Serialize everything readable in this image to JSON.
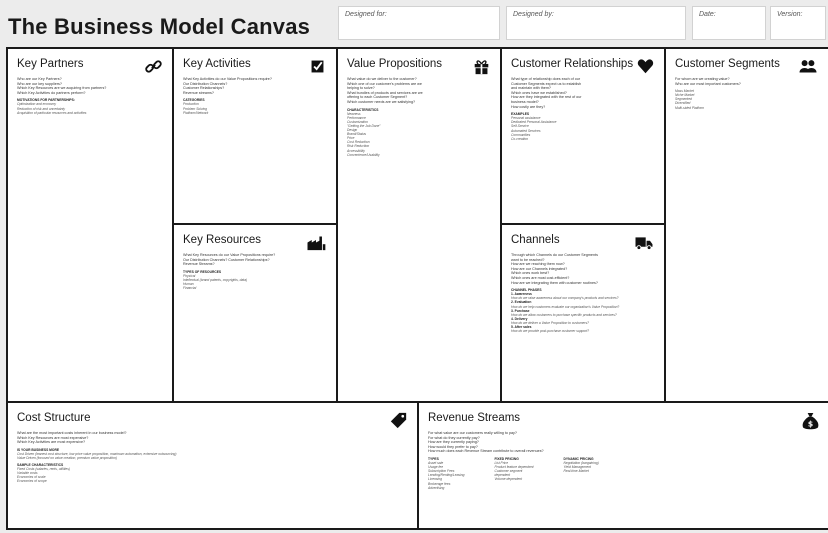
{
  "header": {
    "title": "The Business Model Canvas",
    "designed_for_label": "Designed for:",
    "designed_by_label": "Designed by:",
    "date_label": "Date:",
    "version_label": "Version:"
  },
  "key_partners": {
    "title": "Key Partners",
    "icon": "link-icon",
    "questions": [
      "Who are our Key Partners?",
      "Who are our key suppliers?",
      "Which Key Resources are we acquiring from partners?",
      "Which Key Activities do partners perform?"
    ],
    "section_heading": "MOTIVATIONS FOR PARTNERSHIPS:",
    "section_items": [
      "Optimization and economy",
      "Reduction of risk and uncertainty",
      "Acquisition of particular resources and activities"
    ]
  },
  "key_activities": {
    "title": "Key Activities",
    "icon": "checkbox-icon",
    "questions": [
      "What Key Activities do our Value Propositions require?",
      "Our Distribution Channels?",
      "Customer Relationships?",
      "Revenue streams?"
    ],
    "section_heading": "CATEGORIES",
    "section_items": [
      "Production",
      "Problem Solving",
      "Platform/Network"
    ]
  },
  "key_resources": {
    "title": "Key Resources",
    "icon": "factory-icon",
    "questions": [
      "What Key Resources do our Value Propositions require?",
      "Our Distribution Channels? Customer Relationships?",
      "Revenue Streams?"
    ],
    "section_heading": "TYPES OF RESOURCES",
    "section_items": [
      "Physical",
      "Intellectual (brand patents, copyrights, data)",
      "Human",
      "Financial"
    ]
  },
  "value_propositions": {
    "title": "Value Propositions",
    "icon": "gift-icon",
    "questions": [
      "What value do we deliver to the customer?",
      "Which one of our customer's problems are we",
      "helping to solve?",
      "What bundles of products and services are we",
      "offering to each Customer Segment?",
      "Which customer needs are we satisfying?"
    ],
    "section_heading": "CHARACTERISTICS",
    "section_items": [
      "Newness",
      "Performance",
      "Customization",
      "\"Getting the Job Done\"",
      "Design",
      "Brand/Status",
      "Price",
      "Cost Reduction",
      "Risk Reduction",
      "Accessibility",
      "Convenience/Usability"
    ]
  },
  "customer_relationships": {
    "title": "Customer Relationships",
    "icon": "heart-icon",
    "questions": [
      "What type of relationship does each of our",
      "Customer Segments expect us to establish",
      "and maintain with them?",
      "Which ones have we established?",
      "How are they integrated with the rest of our",
      "business model?",
      "How costly are they?"
    ],
    "section_heading": "EXAMPLES",
    "section_items": [
      "Personal assistance",
      "Dedicated Personal Assistance",
      "Self-Service",
      "Automated Services",
      "Communities",
      "Co-creation"
    ]
  },
  "channels": {
    "title": "Channels",
    "icon": "truck-icon",
    "questions": [
      "Through which Channels do our Customer Segments",
      "want to be reached?",
      "How are we reaching them now?",
      "How are our Channels integrated?",
      "Which ones work best?",
      "Which ones are most cost-efficient?",
      "How are we integrating them with customer routines?"
    ],
    "section_heading": "CHANNEL PHASES",
    "phases": [
      {
        "label": "1. Awareness",
        "detail": "How do we raise awareness about our company's products and services?"
      },
      {
        "label": "2. Evaluation",
        "detail": "How do we help customers evaluate our organization's Value Proposition?"
      },
      {
        "label": "3. Purchase",
        "detail": "How do we allow customers to purchase specific products and services?"
      },
      {
        "label": "4. Delivery",
        "detail": "How do we deliver a Value Proposition to customers?"
      },
      {
        "label": "5. After sales",
        "detail": "How do we provide post-purchase customer support?"
      }
    ]
  },
  "customer_segments": {
    "title": "Customer Segments",
    "icon": "people-icon",
    "questions": [
      "For whom are we creating value?",
      "Who are our most important customers?"
    ],
    "section_items": [
      "Mass Market",
      "Niche Market",
      "Segmented",
      "Diversified",
      "Multi-sided Platform"
    ]
  },
  "cost_structure": {
    "title": "Cost Structure",
    "icon": "tag-icon",
    "questions": [
      "What are the most important costs inherent in our business model?",
      "Which Key Resources are most expensive?",
      "Which Key Activities are most expensive?"
    ],
    "section_heading": "IS YOUR BUSINESS MORE",
    "section_items": [
      "Cost Driven (leanest cost structure, low price value proposition, maximum automation, extensive outsourcing)",
      "Value Driven (focused on value creation, premium value proposition)"
    ],
    "section2_heading": "SAMPLE CHARACTERISTICS",
    "section2_items": [
      "Fixed Costs (salaries, rents, utilities)",
      "Variable costs",
      "Economies of scale",
      "Economies of scope"
    ]
  },
  "revenue_streams": {
    "title": "Revenue Streams",
    "icon": "money-bag-icon",
    "questions": [
      "For what value are our customers really willing to pay?",
      "For what do they currently pay?",
      "How are they currently paying?",
      "How would they prefer to pay?",
      "How much does each Revenue Stream contribute to overall revenues?"
    ],
    "columns": [
      {
        "heading": "TYPES",
        "items": [
          "Asset sale",
          "Usage fee",
          "Subscription Fees",
          "Lending/Renting/Leasing",
          "Licensing",
          "Brokerage fees",
          "Advertising"
        ]
      },
      {
        "heading": "FIXED PRICING",
        "items": [
          "List Price",
          "Product feature dependent",
          "Customer segment",
          "dependent",
          "Volume dependent"
        ]
      },
      {
        "heading": "DYNAMIC PRICING",
        "items": [
          "Negotiation (bargaining)",
          "Yield Management",
          "Real-time-Market"
        ]
      }
    ]
  }
}
